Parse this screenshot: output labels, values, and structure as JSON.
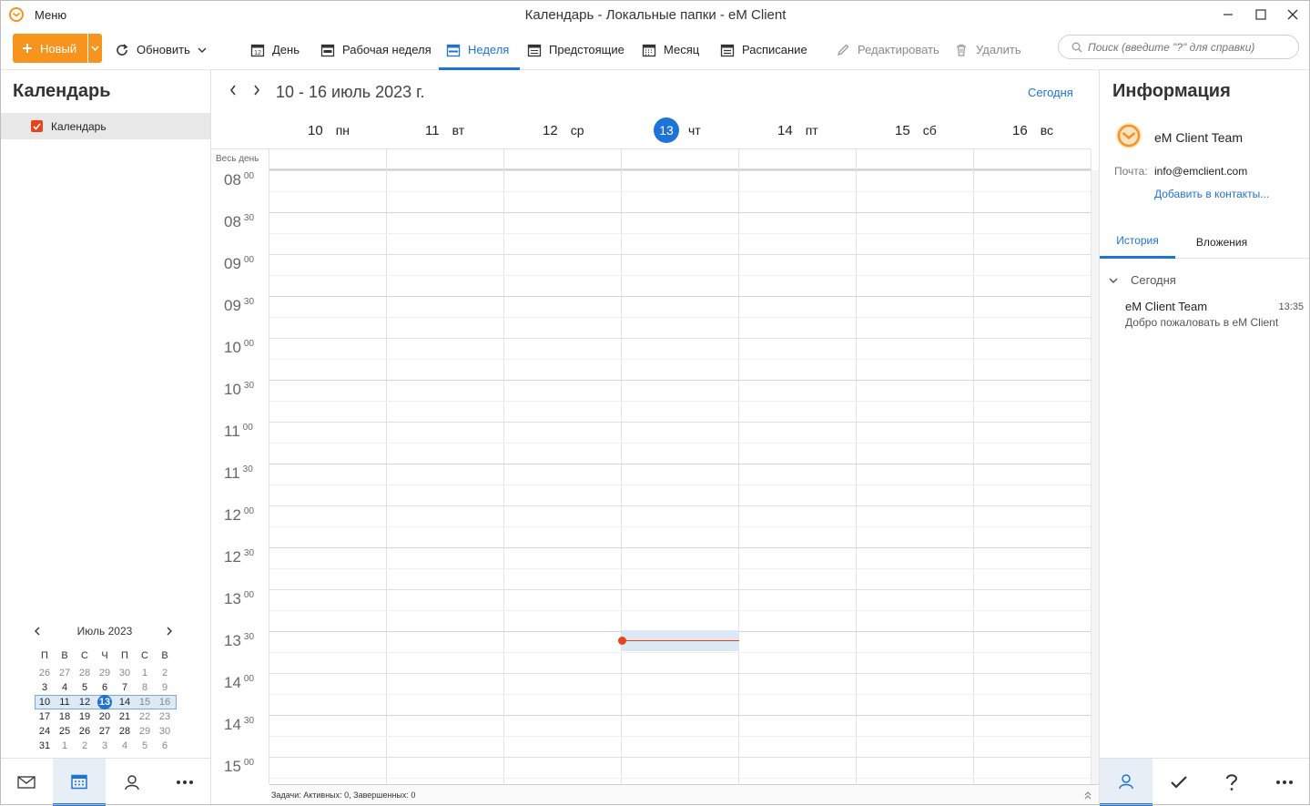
{
  "window": {
    "menu_label": "Меню",
    "title": "Календарь - Локальные папки - eM Client"
  },
  "toolbar": {
    "new_label": "Новый",
    "refresh_label": "Обновить",
    "views": [
      {
        "label": "День",
        "icon": "calendar-day-icon",
        "active": false
      },
      {
        "label": "Рабочая неделя",
        "icon": "calendar-workweek-icon",
        "active": false
      },
      {
        "label": "Неделя",
        "icon": "calendar-week-icon",
        "active": true
      },
      {
        "label": "Предстоящие",
        "icon": "calendar-upcoming-icon",
        "active": false
      },
      {
        "label": "Месяц",
        "icon": "calendar-month-icon",
        "active": false
      },
      {
        "label": "Расписание",
        "icon": "calendar-schedule-icon",
        "active": false
      }
    ],
    "edit_label": "Редактировать",
    "delete_label": "Удалить",
    "search_placeholder": "Поиск (введите \"?\" для справки)"
  },
  "sidebar": {
    "title": "Календарь",
    "calendars": [
      {
        "label": "Календарь",
        "checked": true,
        "color": "#e8431b"
      }
    ]
  },
  "mini_calendar": {
    "month_label": "Июль 2023",
    "weekday_headers": [
      "П",
      "В",
      "С",
      "Ч",
      "П",
      "С",
      "В"
    ],
    "weeks": [
      [
        "26",
        "27",
        "28",
        "29",
        "30",
        "1",
        "2"
      ],
      [
        "3",
        "4",
        "5",
        "6",
        "7",
        "8",
        "9"
      ],
      [
        "10",
        "11",
        "12",
        "13",
        "14",
        "15",
        "16"
      ],
      [
        "17",
        "18",
        "19",
        "20",
        "21",
        "22",
        "23"
      ],
      [
        "24",
        "25",
        "26",
        "27",
        "28",
        "29",
        "30"
      ],
      [
        "31",
        "1",
        "2",
        "3",
        "4",
        "5",
        "6"
      ]
    ],
    "selected_week_index": 2,
    "today": "13"
  },
  "calendar": {
    "range_title": "10 - 16 июль 2023 г.",
    "today_button": "Сегодня",
    "allday_label": "Весь день",
    "days": [
      {
        "num": "10",
        "name": "пн",
        "today": false
      },
      {
        "num": "11",
        "name": "вт",
        "today": false
      },
      {
        "num": "12",
        "name": "ср",
        "today": false
      },
      {
        "num": "13",
        "name": "чт",
        "today": true
      },
      {
        "num": "14",
        "name": "пт",
        "today": false
      },
      {
        "num": "15",
        "name": "сб",
        "today": false
      },
      {
        "num": "16",
        "name": "вс",
        "today": false
      }
    ],
    "time_slots": [
      {
        "h": "08",
        "m": "00"
      },
      {
        "h": "08",
        "m": "30"
      },
      {
        "h": "09",
        "m": "00"
      },
      {
        "h": "09",
        "m": "30"
      },
      {
        "h": "10",
        "m": "00"
      },
      {
        "h": "10",
        "m": "30"
      },
      {
        "h": "11",
        "m": "00"
      },
      {
        "h": "11",
        "m": "30"
      },
      {
        "h": "12",
        "m": "00"
      },
      {
        "h": "12",
        "m": "30"
      },
      {
        "h": "13",
        "m": "00"
      },
      {
        "h": "13",
        "m": "30"
      },
      {
        "h": "14",
        "m": "00"
      },
      {
        "h": "14",
        "m": "30"
      },
      {
        "h": "15",
        "m": "00"
      }
    ],
    "current_time": "13:35",
    "tasks_status": "Задачи: Активных: 0, Завершенных: 0"
  },
  "info_panel": {
    "title": "Информация",
    "contact_name": "eM Client Team",
    "email_label": "Почта:",
    "email": "info@emclient.com",
    "add_contact_link": "Добавить в контакты...",
    "tabs": [
      {
        "label": "История",
        "active": true
      },
      {
        "label": "Вложения",
        "active": false
      }
    ],
    "group_label": "Сегодня",
    "history": [
      {
        "sender": "eM Client Team",
        "time": "13:35",
        "subject": "Добро пожаловать в eM Client"
      }
    ]
  },
  "colors": {
    "accent": "#1e73d8",
    "brand_orange": "#f7941d",
    "now_line": "#e8431b"
  },
  "bottom_nav_left": [
    "mail-icon",
    "calendar-icon",
    "contacts-icon",
    "more-icon"
  ],
  "bottom_nav_right": [
    "contact-info-icon",
    "tasks-icon",
    "help-icon",
    "more-icon"
  ]
}
